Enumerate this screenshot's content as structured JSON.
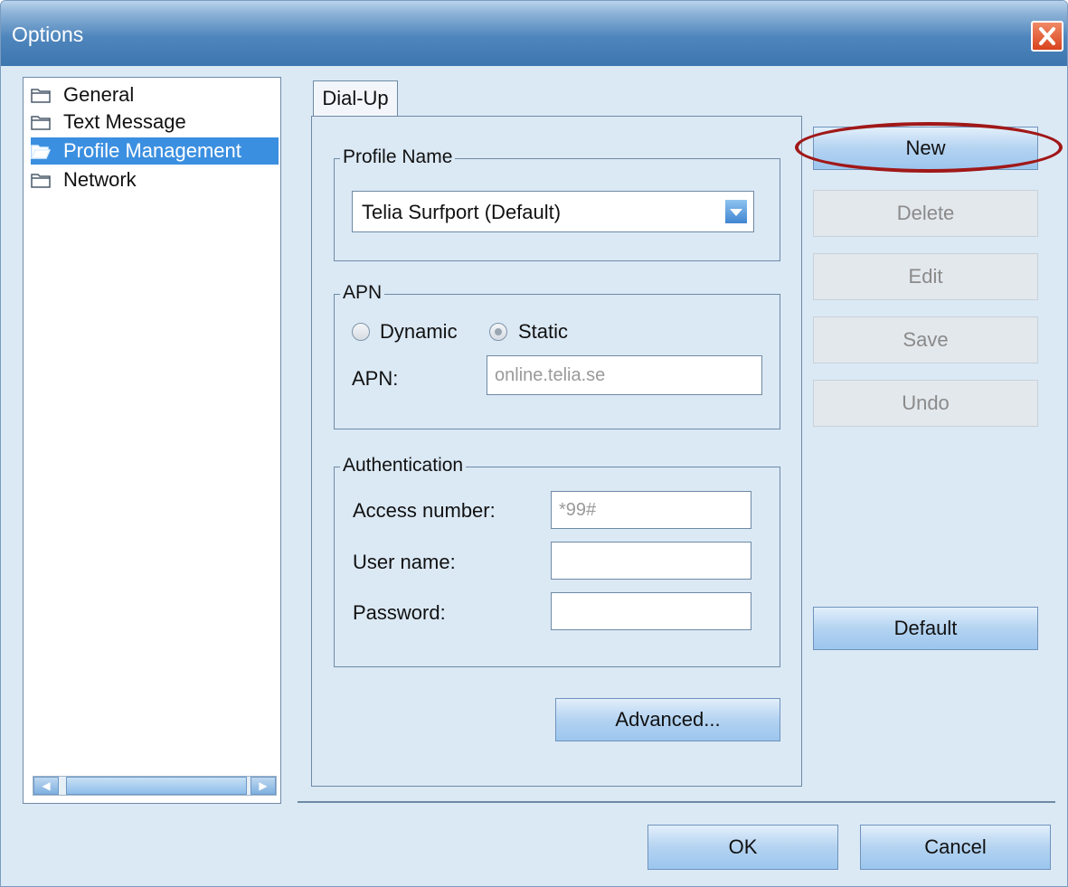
{
  "window": {
    "title": "Options"
  },
  "tree": {
    "items": [
      {
        "label": "General",
        "selected": false
      },
      {
        "label": "Text Message",
        "selected": false
      },
      {
        "label": "Profile Management",
        "selected": true
      },
      {
        "label": "Network",
        "selected": false
      }
    ]
  },
  "tab": {
    "label": "Dial-Up"
  },
  "profile": {
    "group_label": "Profile Name",
    "selected_value": "Telia Surfport (Default)"
  },
  "apn": {
    "group_label": "APN",
    "dynamic_label": "Dynamic",
    "static_label": "Static",
    "selected_mode": "Static",
    "field_label": "APN:",
    "field_value": "online.telia.se"
  },
  "auth": {
    "group_label": "Authentication",
    "access_label": "Access number:",
    "access_value": "*99#",
    "user_label": "User name:",
    "user_value": "",
    "password_label": "Password:",
    "password_value": ""
  },
  "buttons": {
    "advanced": "Advanced...",
    "new": "New",
    "delete": "Delete",
    "edit": "Edit",
    "save": "Save",
    "undo": "Undo",
    "default": "Default",
    "ok": "OK",
    "cancel": "Cancel"
  },
  "colors": {
    "title_bar": "#3d75ae",
    "selection": "#3b8fe0",
    "annotation_ring": "#a01818"
  },
  "icons": [
    "close-icon",
    "folder-icon",
    "folder-open-icon",
    "chevron-down-icon",
    "arrow-left-icon",
    "arrow-right-icon"
  ]
}
